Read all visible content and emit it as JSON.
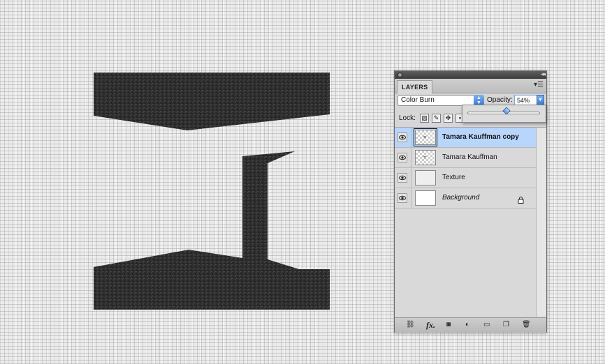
{
  "panel": {
    "tab_label": "LAYERS",
    "collapse_glyph": "◂◂",
    "menu_glyph": "▾☰",
    "blend_mode": "Color Burn",
    "opacity_label": "Opacity:",
    "opacity_value": "54%",
    "opacity_fraction": 0.54,
    "lock_label": "Lock:",
    "lock_buttons": [
      "lock-transparent-pixels-icon",
      "lock-image-pixels-icon",
      "lock-position-icon",
      "lock-all-icon"
    ],
    "layers": [
      {
        "name": "Tamara Kauffman copy",
        "selected": true,
        "visible": true,
        "thumb": "checker",
        "style": "bold"
      },
      {
        "name": "Tamara Kauffman",
        "selected": false,
        "visible": true,
        "thumb": "checker",
        "style": "normal"
      },
      {
        "name": "Texture",
        "selected": false,
        "visible": true,
        "thumb": "textured",
        "style": "normal"
      },
      {
        "name": "Background",
        "selected": false,
        "visible": true,
        "thumb": "white",
        "style": "italic",
        "locked": true
      }
    ],
    "bottom_icons": [
      "link-layers-icon",
      "fx-icon",
      "add-mask-icon",
      "adjustment-layer-icon",
      "new-group-icon",
      "new-layer-icon",
      "delete-layer-icon"
    ],
    "fx_label": "fx."
  },
  "colors": {
    "selected_row": "#b8d5fb",
    "accent_blue": "#3a78cf",
    "art_fill": "#2e2d2d"
  }
}
